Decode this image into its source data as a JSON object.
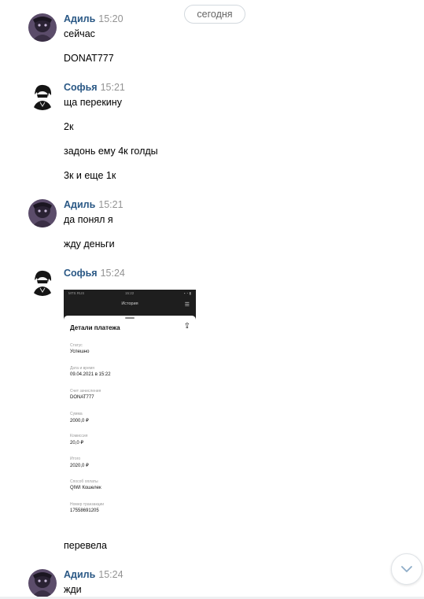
{
  "date_separator": "сегодня",
  "messages": [
    {
      "author": "Адиль",
      "time": "15:20",
      "lines": [
        "сейчас",
        "DONAT777"
      ]
    },
    {
      "author": "Софья",
      "time": "15:21",
      "lines": [
        "ща перекину",
        "2к",
        "задонь ему 4к голды",
        "3к и еще 1к"
      ]
    },
    {
      "author": "Адиль",
      "time": "15:21",
      "lines": [
        "да понял я",
        "жду деньги"
      ]
    },
    {
      "author": "Софья",
      "time": "15:24",
      "lines": [
        "перевела"
      ]
    },
    {
      "author": "Адиль",
      "time": "15:24",
      "lines": [
        "жди"
      ]
    }
  ],
  "attachment": {
    "status_left": "MTS RUS",
    "status_time": "15:22",
    "nav_title": "История",
    "title": "Детали платежа",
    "fields": [
      {
        "label": "Статус",
        "value": "Успешно"
      },
      {
        "label": "Дата и время",
        "value": "09.04.2021 в 15:22"
      },
      {
        "label": "Счет зачисления",
        "value": "DONAT777"
      },
      {
        "label": "Сумма",
        "value": "2000,0 ₽"
      },
      {
        "label": "Комиссия",
        "value": "20,0 ₽"
      },
      {
        "label": "Итого",
        "value": "2020,0 ₽"
      },
      {
        "label": "Способ оплаты",
        "value": "QIWI Кошелек"
      },
      {
        "label": "Номер транзакции",
        "value": "17558691205"
      }
    ]
  },
  "icons": {
    "scroll_down": "chevron-down-icon",
    "share": "share-icon",
    "menu": "menu-icon"
  }
}
